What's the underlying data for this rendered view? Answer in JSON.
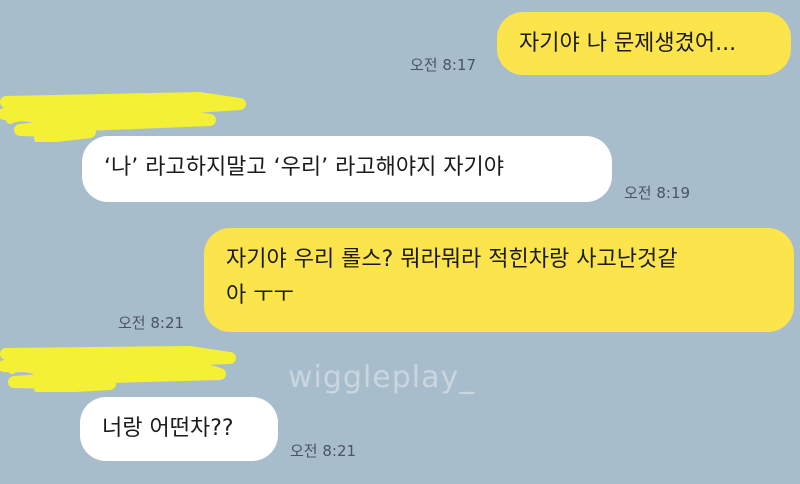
{
  "colors": {
    "background": "#a8bdcc",
    "my_bubble": "#fbe44c",
    "their_bubble": "#ffffff",
    "timestamp": "#4a5560",
    "redaction": "#f3f036"
  },
  "watermark": "wiggleplay_",
  "messages": [
    {
      "sender": "me",
      "lines": [
        "자기야 나 문제생겼어..."
      ],
      "time": "오전 8:17"
    },
    {
      "sender": "them",
      "lines": [
        "‘나’ 라고하지말고 ‘우리’ 라고해야지 자기야"
      ],
      "time": "오전 8:19"
    },
    {
      "sender": "me",
      "lines": [
        "자기야 우리 롤스? 뭐라뭐라 적힌차랑 사고난것같",
        "아 ㅜㅜ"
      ],
      "time": "오전 8:21"
    },
    {
      "sender": "them",
      "lines": [
        "너랑 어떤차??"
      ],
      "time": "오전 8:21"
    }
  ],
  "redactions": [
    {
      "covers": "sender-name-and-avatar"
    },
    {
      "covers": "sender-name-and-avatar"
    }
  ]
}
